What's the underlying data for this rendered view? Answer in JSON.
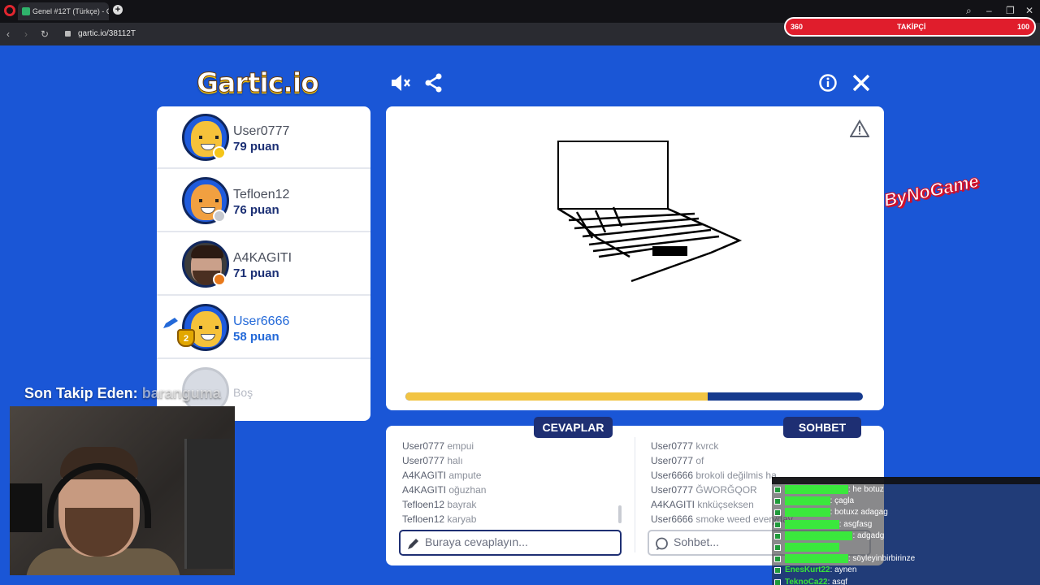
{
  "browser": {
    "tab_title": "Genel #12T (Türkçe) - Gar",
    "new_tab": "+",
    "url": "gartic.io/38112T",
    "follower_bar": {
      "left": "360",
      "label": "TAKİPÇİ",
      "right": "100"
    }
  },
  "header": {
    "logo": "Gartic.io"
  },
  "players": [
    {
      "name": "User0777",
      "score": "79 puan",
      "status_color": "#f5c518",
      "style": "yellow"
    },
    {
      "name": "Tefloen12",
      "score": "76 puan",
      "status_color": "#c6c9cf",
      "style": "orange"
    },
    {
      "name": "A4KAGITI",
      "score": "71 puan",
      "status_color": "#e8791b",
      "style": "human"
    },
    {
      "name": "User6666",
      "score": "58 puan",
      "status_color": "",
      "style": "yellow",
      "drawing": true,
      "rank": "2"
    }
  ],
  "empty_slot": {
    "name": "Boş"
  },
  "canvas": {
    "round_progress": 0.66
  },
  "answers": {
    "title": "CEVAPLAR",
    "messages": [
      {
        "user": "User0777",
        "text": "empui"
      },
      {
        "user": "User0777",
        "text": "halı"
      },
      {
        "user": "A4KAGITI",
        "text": "ampute"
      },
      {
        "user": "A4KAGITI",
        "text": "oğuzhan"
      },
      {
        "user": "Tefloen12",
        "text": "bayrak"
      },
      {
        "user": "Tefloen12",
        "text": "karyab"
      }
    ],
    "placeholder": "Buraya cevaplayın..."
  },
  "chat": {
    "title": "SOHBET",
    "messages": [
      {
        "user": "User0777",
        "text": "kvrck"
      },
      {
        "user": "User0777",
        "text": "of"
      },
      {
        "user": "User6666",
        "text": "brokoli değilmis ha"
      },
      {
        "user": "User0777",
        "text": "ĞWORĞQOR"
      },
      {
        "user": "A4KAGITI",
        "text": "knküçseksen"
      },
      {
        "user": "User6666",
        "text": "smoke weed everyday"
      }
    ],
    "placeholder": "Sohbet..."
  },
  "stream": {
    "follow_label": "Son Takip Eden:",
    "follow_name": "baranguma",
    "sticker": "ByNoGame",
    "chat": [
      {
        "user": "",
        "text": ": he botuz"
      },
      {
        "user": "",
        "text": ": çagla"
      },
      {
        "user": "",
        "text": ": botuxz adagag"
      },
      {
        "user": "",
        "text": ": asgfasg"
      },
      {
        "user": "",
        "text": ": adgadg"
      },
      {
        "user": "",
        "text": ""
      },
      {
        "user": "",
        "text": ": söyleyinbirbirinze"
      },
      {
        "user": "EnesKurt22",
        "text": ": aynen"
      },
      {
        "user": "TeknoCa22",
        "text": ": asgf"
      }
    ]
  }
}
